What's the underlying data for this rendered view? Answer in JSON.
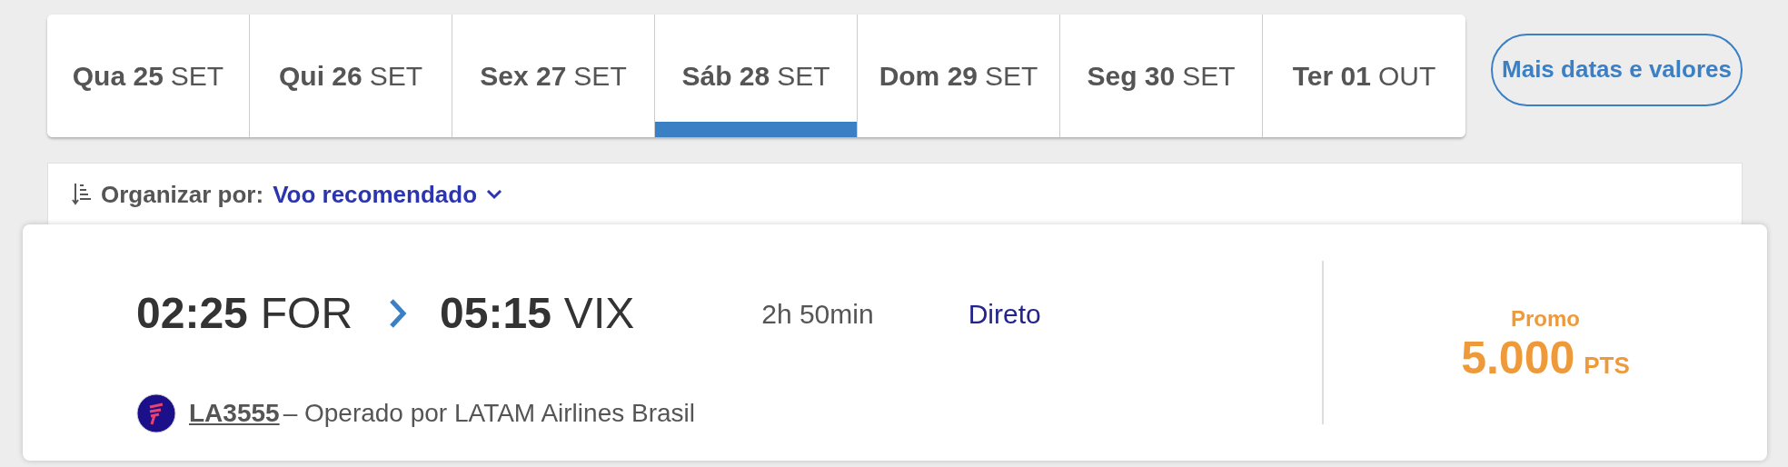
{
  "date_tabs": [
    {
      "day": "Qua 25",
      "month": "SET",
      "selected": false
    },
    {
      "day": "Qui 26",
      "month": "SET",
      "selected": false
    },
    {
      "day": "Sex 27",
      "month": "SET",
      "selected": false
    },
    {
      "day": "Sáb 28",
      "month": "SET",
      "selected": true
    },
    {
      "day": "Dom 29",
      "month": "SET",
      "selected": false
    },
    {
      "day": "Seg 30",
      "month": "SET",
      "selected": false
    },
    {
      "day": "Ter 01",
      "month": "OUT",
      "selected": false
    }
  ],
  "more_dates_button": "Mais datas e valores",
  "sort": {
    "label": "Organizar por:",
    "value": "Voo recomendado"
  },
  "flight": {
    "departure_time": "02:25",
    "origin": "FOR",
    "arrival_time": "05:15",
    "destination": "VIX",
    "duration": "2h 50min",
    "stops": "Direto",
    "flight_number": "LA3555",
    "operator": "– Operado por LATAM Airlines Brasil",
    "price_label": "Promo",
    "price": "5.000",
    "price_unit": "PTS"
  }
}
